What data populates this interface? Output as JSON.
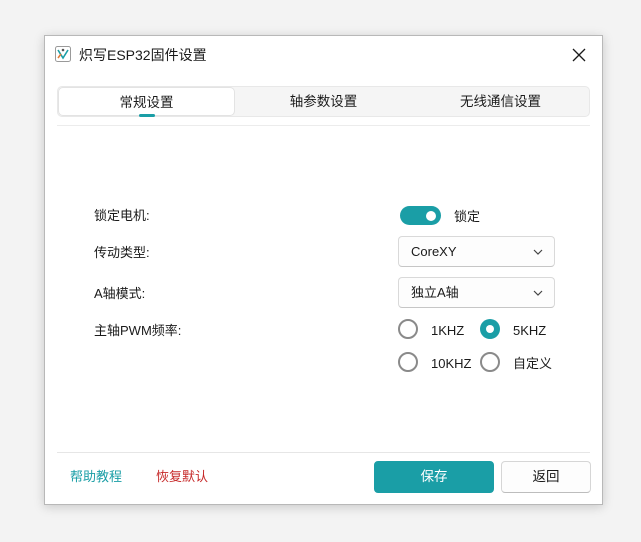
{
  "window": {
    "title": "炽写ESP32固件设置",
    "icon": "app-logo-icon",
    "close_icon": "close-icon"
  },
  "tabs": [
    {
      "label": "常规设置",
      "active": true
    },
    {
      "label": "轴参数设置",
      "active": false
    },
    {
      "label": "无线通信设置",
      "active": false
    }
  ],
  "settings": {
    "lock_motor": {
      "label": "锁定电机:",
      "state_text": "锁定",
      "on": true
    },
    "transmission_type": {
      "label": "传动类型:",
      "value": "CoreXY"
    },
    "a_axis_mode": {
      "label": "A轴模式:",
      "value": "独立A轴"
    },
    "spindle_pwm": {
      "label": "主轴PWM频率:",
      "options": [
        {
          "label": "1KHZ",
          "selected": false
        },
        {
          "label": "5KHZ",
          "selected": true
        },
        {
          "label": "10KHZ",
          "selected": false
        },
        {
          "label": "自定义",
          "selected": false
        }
      ]
    }
  },
  "footer": {
    "help_link": "帮助教程",
    "reset_link": "恢复默认",
    "save_button": "保存",
    "back_button": "返回"
  },
  "colors": {
    "accent": "#1a9ea6",
    "help_link": "#1a9ea6",
    "reset_link": "#c62828"
  }
}
